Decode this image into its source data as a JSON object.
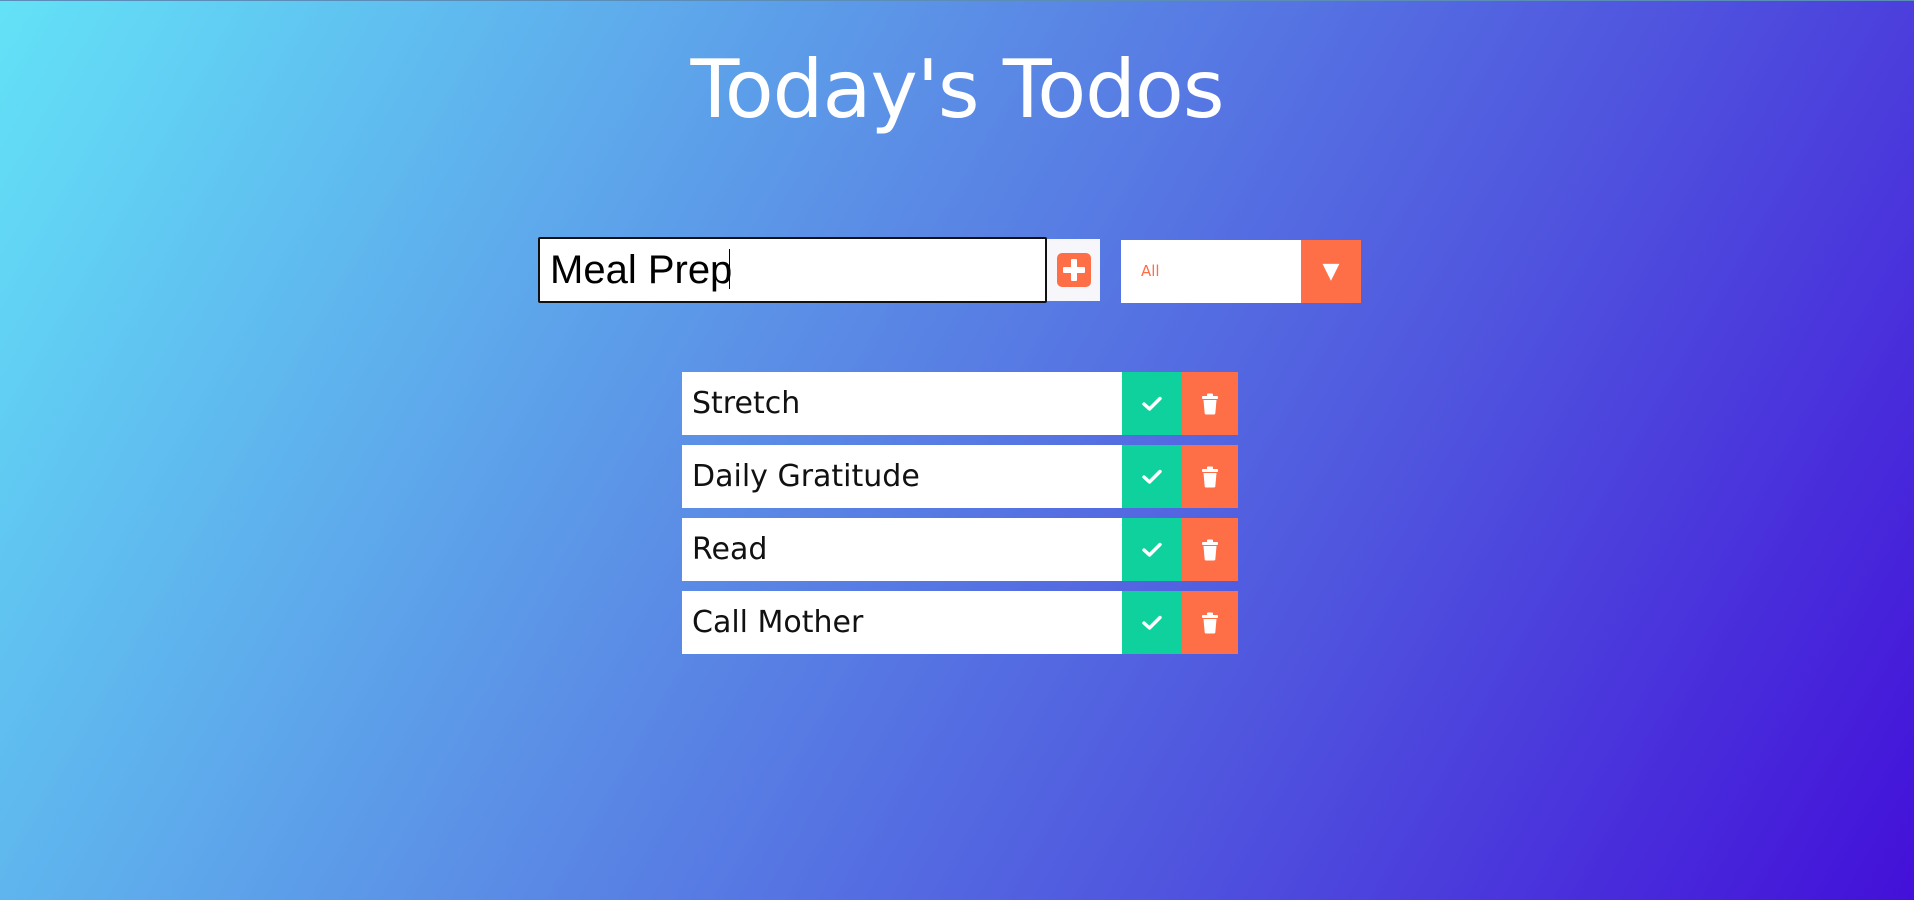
{
  "header": {
    "title": "Today's Todos"
  },
  "form": {
    "input_value": "Meal Prep",
    "add_icon": "plus-square-icon",
    "filter": {
      "selected": "All",
      "arrow": "▼"
    }
  },
  "todos": [
    {
      "text": "Stretch"
    },
    {
      "text": "Daily Gratitude"
    },
    {
      "text": "Read"
    },
    {
      "text": "Call Mother"
    }
  ],
  "colors": {
    "accent": "#ff6f47",
    "complete": "#0fd19e",
    "gradient_start": "#63e2f7",
    "gradient_end": "#4310d9"
  }
}
